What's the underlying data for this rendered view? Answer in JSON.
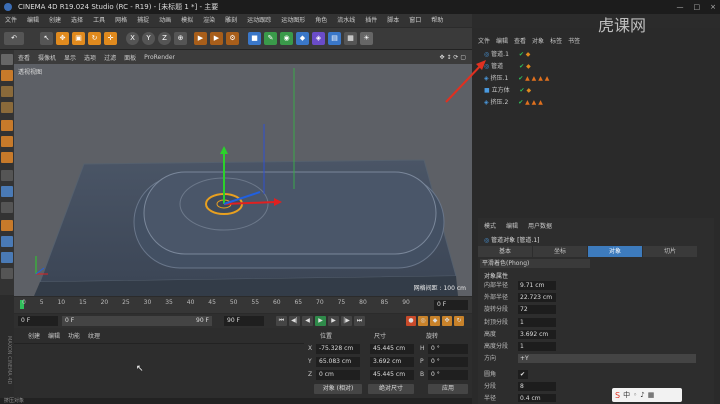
{
  "window": {
    "title": "CINEMA 4D R19.024 Studio (RC - R19) - [未标题 1 *] - 主要",
    "controls": [
      "—",
      "□",
      "×"
    ]
  },
  "menu": [
    "文件",
    "编辑",
    "创建",
    "选择",
    "工具",
    "网格",
    "捕捉",
    "动画",
    "模拟",
    "渲染",
    "雕刻",
    "运动跟踪",
    "运动图形",
    "角色",
    "流水线",
    "插件",
    "脚本",
    "窗口",
    "帮助"
  ],
  "viewport": {
    "header": [
      "查看",
      "摄像机",
      "显示",
      "选项",
      "过滤",
      "面板",
      "ProRender"
    ],
    "label": "透视视图",
    "grid_info": "网格间距 : 100 cm"
  },
  "timeline": {
    "ticks": [
      "0",
      "5",
      "10",
      "15",
      "20",
      "25",
      "30",
      "35",
      "40",
      "45",
      "50",
      "55",
      "60",
      "65",
      "70",
      "75",
      "80",
      "85",
      "90"
    ],
    "frame_end": "0 F",
    "start": "0 F",
    "current": "0 F",
    "range_end": "90 F",
    "range_end2": "90 F"
  },
  "material": {
    "tabs": [
      "创建",
      "编辑",
      "功能",
      "纹理"
    ]
  },
  "coords": {
    "headers": [
      "位置",
      "尺寸",
      "旋转"
    ],
    "rows": [
      {
        "axis": "X",
        "pos": "-75.328 cm",
        "size": "45.445 cm",
        "rot_label": "H",
        "rot": "0 °"
      },
      {
        "axis": "Y",
        "pos": "65.083 cm",
        "size": "3.692 cm",
        "rot_label": "P",
        "rot": "0 °"
      },
      {
        "axis": "Z",
        "pos": "0 cm",
        "size": "45.445 cm",
        "rot_label": "B",
        "rot": "0 °"
      }
    ],
    "mode": "对象 (相对)",
    "size_mode": "绝对尺寸",
    "apply": "应用"
  },
  "objects": {
    "tabs": [
      "文件",
      "编辑",
      "查看",
      "对象",
      "标签",
      "书签"
    ],
    "items": [
      "管道.1",
      "管道",
      "挤压.1",
      "立方体",
      "挤压.2"
    ]
  },
  "attributes": {
    "header_tabs": [
      "模式",
      "编辑",
      "用户数据"
    ],
    "object_name": "管道对象 [管道.1]",
    "tabs": [
      "基本",
      "坐标",
      "对象",
      "切片"
    ],
    "active_tab": "对象",
    "phong": "平滑着色(Phong)",
    "section": "对象属性",
    "rows": [
      {
        "label": "内部半径",
        "value": "9.71 cm"
      },
      {
        "label": "外部半径",
        "value": "22.723 cm"
      },
      {
        "label": "旋转分段",
        "value": "72"
      },
      {
        "label": "封顶分段",
        "value": "1"
      },
      {
        "label": "高度",
        "value": "3.692 cm"
      },
      {
        "label": "高度分段",
        "value": "1"
      },
      {
        "label": "方向",
        "value": "+Y"
      },
      {
        "label": "圆角",
        "value": "✔"
      },
      {
        "label": "分段",
        "value": "8"
      },
      {
        "label": "半径",
        "value": "0.4 cm"
      }
    ]
  },
  "watermark": "虎课网",
  "status": "挤压对象"
}
